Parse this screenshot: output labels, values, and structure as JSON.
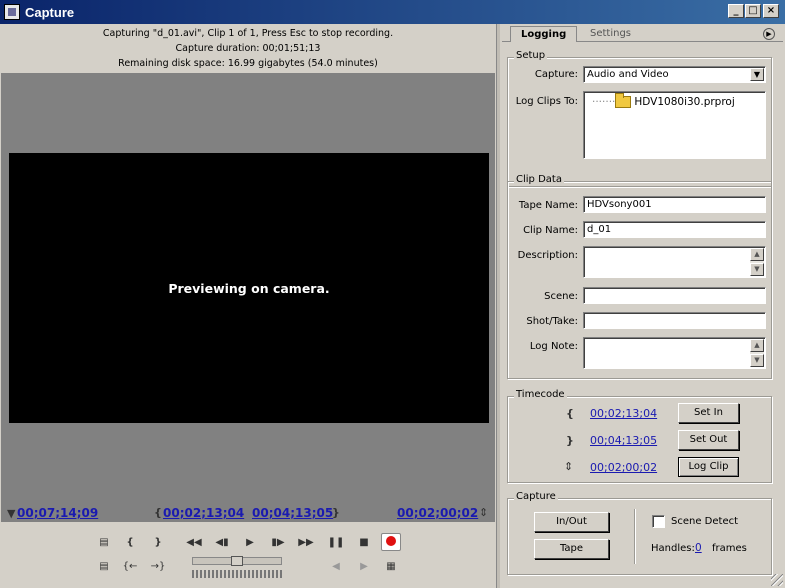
{
  "window": {
    "title": "Capture"
  },
  "status": {
    "line1": "Capturing \"d_01.avi\", Clip 1 of 1, Press Esc to stop recording.",
    "line2": "Capture duration: 00;01;51;13",
    "line3": "Remaining disk space: 16.99 gigabytes (54.0 minutes)"
  },
  "preview": {
    "message": "Previewing on camera."
  },
  "timecodes": {
    "current": "00;07;14;09",
    "in_point": "00;02;13;04",
    "out_point": "00;04;13;05",
    "duration": "00;02;00;02"
  },
  "tabs": {
    "logging": "Logging",
    "settings": "Settings"
  },
  "setup": {
    "group_label": "Setup",
    "capture_label": "Capture:",
    "capture_value": "Audio and Video",
    "log_clips_label": "Log Clips To:",
    "project_name": "HDV1080i30.prproj"
  },
  "clip_data": {
    "group_label": "Clip Data",
    "tape_name_label": "Tape Name:",
    "tape_name_value": "HDVsony001",
    "clip_name_label": "Clip Name:",
    "clip_name_value": "d_01",
    "description_label": "Description:",
    "description_value": "",
    "scene_label": "Scene:",
    "scene_value": "",
    "shot_take_label": "Shot/Take:",
    "shot_take_value": "",
    "log_note_label": "Log Note:",
    "log_note_value": ""
  },
  "timecode_group": {
    "group_label": "Timecode",
    "in_value": "00;02;13;04",
    "out_value": "00;04;13;05",
    "duration_value": "00;02;00;02",
    "set_in_label": "Set In",
    "set_out_label": "Set Out",
    "log_clip_label": "Log Clip"
  },
  "capture_group": {
    "group_label": "Capture",
    "in_out_label": "In/Out",
    "tape_label": "Tape",
    "scene_detect_label": "Scene Detect",
    "handles_label": "Handles:",
    "handles_value": "0",
    "frames_label": "frames"
  }
}
